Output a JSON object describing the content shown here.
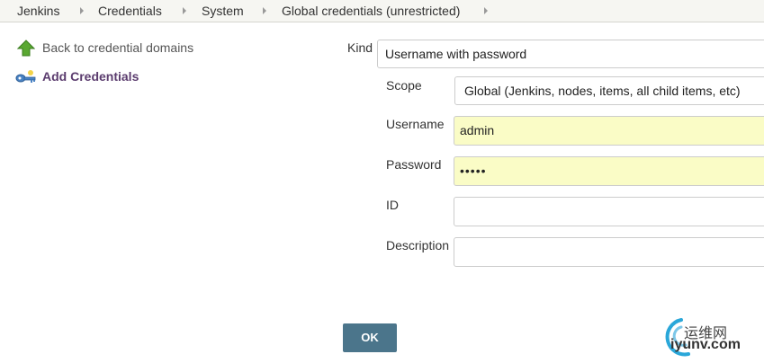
{
  "breadcrumb": {
    "items": [
      "Jenkins",
      "Credentials",
      "System",
      "Global credentials (unrestricted)"
    ]
  },
  "sidebar": {
    "back_label": "Back to credential domains",
    "add_label": "Add Credentials"
  },
  "form": {
    "kind_label": "Kind",
    "kind_value": "Username with password",
    "scope_label": "Scope",
    "scope_value": "Global (Jenkins, nodes, items, all child items, etc)",
    "username_label": "Username",
    "username_value": "admin",
    "password_label": "Password",
    "password_value": "•••••",
    "id_label": "ID",
    "id_value": "",
    "description_label": "Description",
    "description_value": ""
  },
  "actions": {
    "ok_label": "OK"
  },
  "watermark": {
    "cn_text": "运维网",
    "en_text": "iyunv.com"
  },
  "colors": {
    "accent_button": "#4b758b",
    "autofill_bg": "#fafcc6",
    "link_purple": "#5b3c6e"
  }
}
